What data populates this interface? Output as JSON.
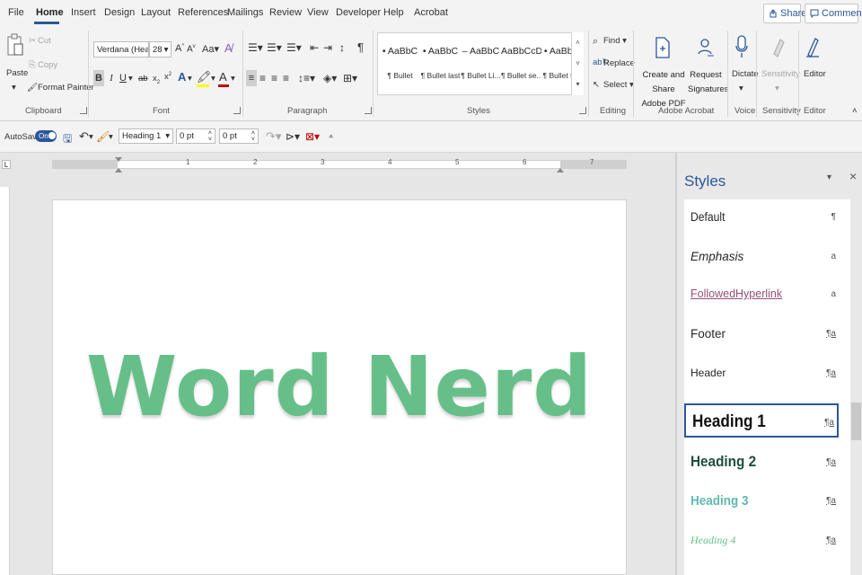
{
  "menu": {
    "tabs": [
      "File",
      "Home",
      "Insert",
      "Design",
      "Layout",
      "References",
      "Mailings",
      "Review",
      "View",
      "Developer",
      "Help",
      "Acrobat"
    ],
    "active_tab": "Home",
    "share_label": "Share",
    "comments_label": "Comments"
  },
  "ribbon": {
    "clipboard": {
      "paste": "Paste",
      "cut": "Cut",
      "copy": "Copy",
      "format_painter": "Format Painter",
      "label": "Clipboard"
    },
    "font": {
      "font_name": "Verdana (Headir",
      "font_size": "28",
      "change_case": "Aa",
      "label": "Font"
    },
    "paragraph": {
      "label": "Paragraph"
    },
    "styles": {
      "items": [
        {
          "sample": "• AaBbC",
          "name": "¶ Bullet"
        },
        {
          "sample": "• AaBbC",
          "name": "¶ Bullet last"
        },
        {
          "sample": "– AaBbC",
          "name": "¶ Bullet Li..."
        },
        {
          "sample": "AaBbCcD",
          "name": "¶ Bullet se..."
        },
        {
          "sample": "• AaBbC",
          "name": "¶ Bullet ti..."
        }
      ],
      "label": "Styles"
    },
    "editing": {
      "find": "Find",
      "replace": "Replace",
      "select": "Select",
      "label": "Editing"
    },
    "acrobat": {
      "create_share_1": "Create and Share",
      "create_share_2": "Adobe PDF",
      "request_1": "Request",
      "request_2": "Signatures",
      "label": "Adobe Acrobat"
    },
    "voice": {
      "dictate": "Dictate",
      "label": "Voice"
    },
    "sensitivity": {
      "button": "Sensitivity",
      "label": "Sensitivity"
    },
    "editor": {
      "button": "Editor",
      "label": "Editor"
    }
  },
  "qat": {
    "autosave_label": "AutoSave",
    "autosave_state": "On",
    "style_box": "Heading 1",
    "space_before": "0 pt",
    "space_after": "0 pt"
  },
  "ruler": {
    "left_marker": "L",
    "numbers": [
      "1",
      "2",
      "3",
      "4",
      "5",
      "6",
      "7"
    ]
  },
  "document": {
    "heading_text": "Word Nerd",
    "heading_color": "#66bf88"
  },
  "styles_pane": {
    "title": "Styles",
    "items": [
      {
        "name": "Default",
        "mark": "¶"
      },
      {
        "name": "Emphasis",
        "mark": "a"
      },
      {
        "name": "FollowedHyperlink",
        "mark": "a"
      },
      {
        "name": "Footer",
        "mark": "¶a"
      },
      {
        "name": "Header",
        "mark": "¶a"
      },
      {
        "name": "Heading 1",
        "mark": "¶a"
      },
      {
        "name": "Heading 2",
        "mark": "¶a"
      },
      {
        "name": "Heading 3",
        "mark": "¶a"
      },
      {
        "name": "Heading 4",
        "mark": "¶a"
      }
    ],
    "selected": "Heading 1"
  },
  "colors": {
    "accent": "#2b579a",
    "heading_green": "#66bf88",
    "heading3_teal": "#5fb8b0",
    "heading2_dark": "#1f4e3d",
    "hyperlink_purple": "#954f72"
  }
}
